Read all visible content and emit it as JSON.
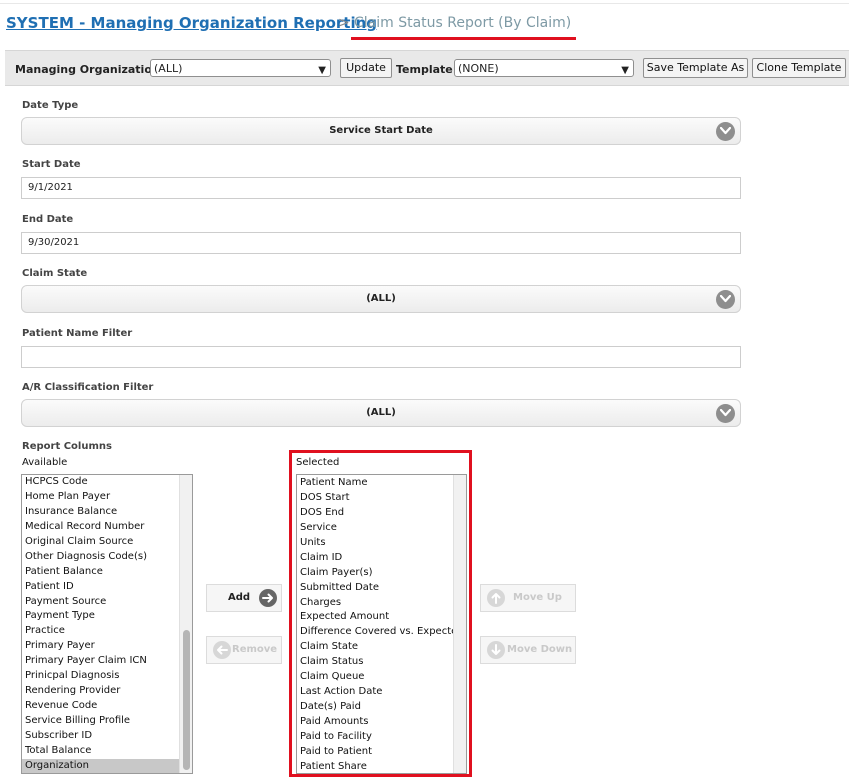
{
  "breadcrumb": {
    "parent": "SYSTEM - Managing Organization Reporting",
    "separator": ">",
    "current": "Claim Status Report (By Claim)"
  },
  "toolbar": {
    "org_label": "Managing Organization:",
    "org_value": "(ALL)",
    "update_label": "Update",
    "template_label": "Template:",
    "template_value": "(NONE)",
    "save_template_label": "Save Template As",
    "clone_template_label": "Clone Template"
  },
  "form": {
    "date_type_label": "Date Type",
    "date_type_value": "Service Start Date",
    "start_date_label": "Start Date",
    "start_date_value": "9/1/2021",
    "end_date_label": "End Date",
    "end_date_value": "9/30/2021",
    "claim_state_label": "Claim State",
    "claim_state_value": "(ALL)",
    "patient_name_label": "Patient Name Filter",
    "patient_name_value": "",
    "ar_class_label": "A/R Classification Filter",
    "ar_class_value": "(ALL)"
  },
  "report_columns": {
    "label": "Report Columns",
    "available_label": "Available",
    "selected_label": "Selected",
    "available": [
      "HCPCS Code",
      "Home Plan Payer",
      "Insurance Balance",
      "Medical Record Number",
      "Original Claim Source",
      "Other Diagnosis Code(s)",
      "Patient Balance",
      "Patient ID",
      "Payment Source",
      "Payment Type",
      "Practice",
      "Primary Payer",
      "Primary Payer Claim ICN",
      "Prinicpal Diagnosis",
      "Rendering Provider",
      "Revenue Code",
      "Service Billing Profile",
      "Subscriber ID",
      "Total Balance",
      "Organization"
    ],
    "available_selected_index": 19,
    "available_scroll_fraction": 0.52,
    "selected": [
      "Patient Name",
      "DOS Start",
      "DOS End",
      "Service",
      "Units",
      "Claim ID",
      "Claim Payer(s)",
      "Submitted Date",
      "Charges",
      "Expected Amount",
      "Difference Covered vs. Expected",
      "Claim State",
      "Claim Status",
      "Claim Queue",
      "Last Action Date",
      "Date(s) Paid",
      "Paid Amounts",
      "Paid to Facility",
      "Paid to Patient",
      "Patient Share"
    ],
    "add_label": "Add",
    "remove_label": "Remove",
    "move_up_label": "Move Up",
    "move_down_label": "Move Down"
  },
  "colors": {
    "link": "#1f6fb3",
    "highlight": "#e0101f",
    "current_crumb": "#7e9aa5"
  }
}
